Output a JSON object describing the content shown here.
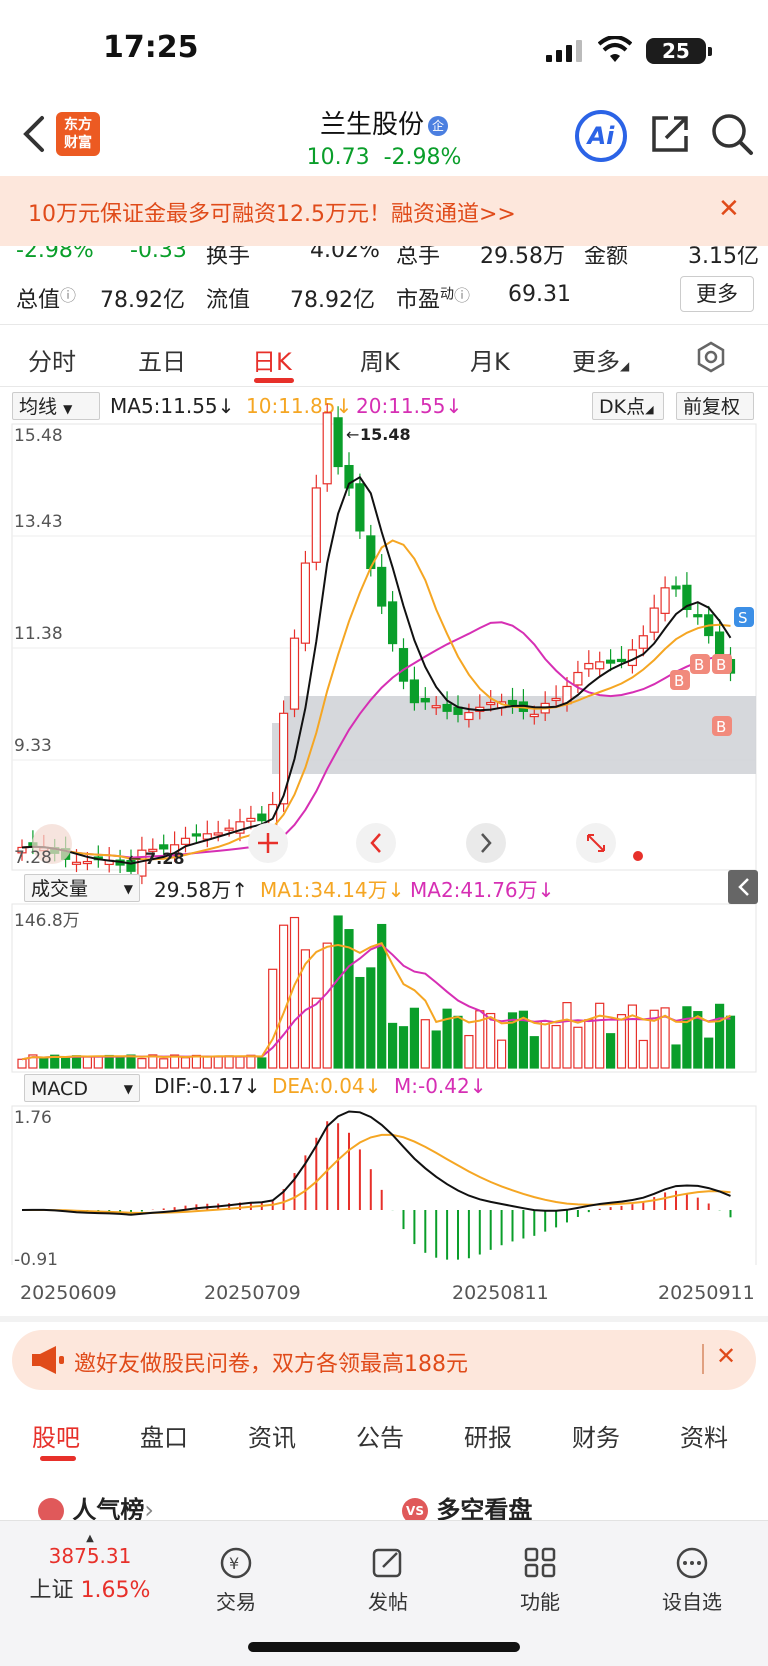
{
  "status_bar": {
    "time": "17:25",
    "battery": "25"
  },
  "header": {
    "logo_line1": "东方",
    "logo_line2": "财富",
    "stock_name": "兰生股份",
    "cert_badge": "企",
    "price": "10.73",
    "change_pct": "-2.98%",
    "ai_label": "Ai"
  },
  "banner": {
    "text": "10万元保证金最多可融资12.5万元！融资通道>>",
    "close": "✕"
  },
  "stats_row1": {
    "pct": "-2.98%",
    "chg": "-0.33",
    "turnover_label": "换手",
    "turnover": "4.02%",
    "volume_label": "总手",
    "volume": "29.58万",
    "amount_label": "金额",
    "amount": "3.15亿"
  },
  "stats_row2": {
    "mktcap_label": "总值",
    "mktcap": "78.92亿",
    "float_label": "流值",
    "float": "78.92亿",
    "pe_label": "市盈",
    "pe_sup": "动",
    "pe": "69.31",
    "more": "更多"
  },
  "period_tabs": [
    "分时",
    "五日",
    "日K",
    "周K",
    "月K",
    "更多"
  ],
  "ma_row": {
    "selector": "均线",
    "ma5": "MA5:11.55",
    "ma10": "10:11.85",
    "ma20": "20:11.55",
    "dk": "DK点",
    "adjust": "前复权"
  },
  "kline": {
    "max_label": "15.48",
    "min_label": "7.28",
    "high_mark": "15.48",
    "low_mark": "7.28",
    "y_ticks": [
      "15.48",
      "13.43",
      "11.38",
      "9.33",
      "7.28"
    ]
  },
  "volume_row": {
    "selector": "成交量",
    "vol": "29.58万",
    "ma1": "MA1:34.14万",
    "ma2": "MA2:41.76万",
    "max_label": "146.8万"
  },
  "macd_row": {
    "selector": "MACD",
    "dif": "DIF:-0.17",
    "dea": "DEA:0.04",
    "m": "M:-0.42",
    "max_label": "1.76",
    "min_label": "-0.91"
  },
  "dates": [
    "20250609",
    "20250709",
    "20250811",
    "20250911"
  ],
  "signals": {
    "buy": "B",
    "sell": "S"
  },
  "invite": {
    "text": "邀好友做股民问卷，双方各领最高188元",
    "close": "✕"
  },
  "bottom_tabs": [
    "股吧",
    "盘口",
    "资讯",
    "公告",
    "研报",
    "财务",
    "资料"
  ],
  "sections": {
    "left": "人气榜",
    "right": "多空看盘"
  },
  "nav": {
    "index_value": "3875.31",
    "index_name": "上证",
    "index_pct": "1.65%",
    "trade": "交易",
    "post": "发帖",
    "func": "功能",
    "watch": "设自选"
  },
  "colors": {
    "up": "#e7302a",
    "down": "#0a9e2a",
    "ma5": "#111111",
    "ma10": "#f5a623",
    "ma20": "#d62fb4",
    "accent": "#e7302a"
  }
}
